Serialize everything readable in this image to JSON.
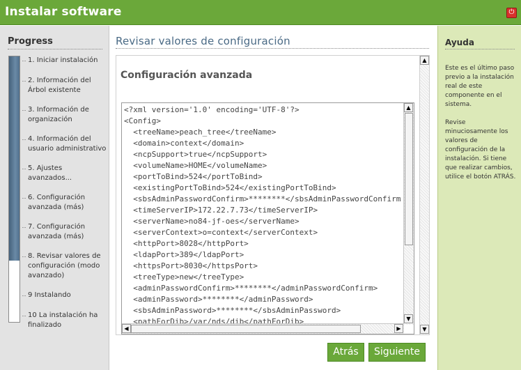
{
  "window": {
    "title": "Instalar software",
    "close_glyph": "⏻"
  },
  "progress": {
    "heading": "Progress",
    "fraction_complete": 0.77,
    "steps": [
      "1. Iniciar instalación",
      "2. Información del Árbol existente",
      "3. Información de organización",
      "4. Información del usuario administrativo",
      "5. Ajustes avanzados...",
      "6. Configuración avanzada (más)",
      "7. Configuración avanzada (más)",
      "8. Revisar valores de configuración (modo avanzado)",
      "9 Instalando",
      "10 La instalación ha finalizado"
    ]
  },
  "main": {
    "page_title": "Revisar valores de configuración",
    "section_title": "Configuración avanzada",
    "config_lines": [
      "<?xml version='1.0' encoding='UTF-8'?>",
      "<Config>",
      "  <treeName>peach_tree</treeName>",
      "  <domain>context</domain>",
      "  <ncpSupport>true</ncpSupport>",
      "  <volumeName>HOME</volumeName>",
      "  <portToBind>524</portToBind>",
      "  <existingPortToBind>524</existingPortToBind>",
      "  <sbsAdminPasswordConfirm>********</sbsAdminPasswordConfirm>",
      "  <timeServerIP>172.22.7.73</timeServerIP>",
      "  <serverName>no84-jf-oes</serverName>",
      "  <serverContext>o=context</serverContext>",
      "  <httpPort>8028</httpPort>",
      "  <ldapPort>389</ldapPort>",
      "  <httpsPort>8030</httpsPort>",
      "  <treeType>new</treeType>",
      "  <adminPasswordConfirm>********</adminPasswordConfirm>",
      "  <adminPassword>********</adminPassword>",
      "  <sbsAdminPassword>********</sbsAdminPassword>",
      "  <pathForDib>/var/nds/dib</pathForDib>"
    ]
  },
  "buttons": {
    "back_label": "Atrás",
    "next_label": "Siguiente"
  },
  "help": {
    "heading": "Ayuda",
    "paragraph1": "Este es el último paso previo a la instalación real de este componente en el sistema.",
    "paragraph2": "Revise minuciosamente los valores de configuración de la instalación. Si tiene que realizar cambios, utilice el botón ATRÁS."
  },
  "colors": {
    "title_bar": "#6ba83a",
    "progress_fill": "#5b7a96",
    "help_background": "#dce9b8",
    "button": "#6aa83a"
  }
}
